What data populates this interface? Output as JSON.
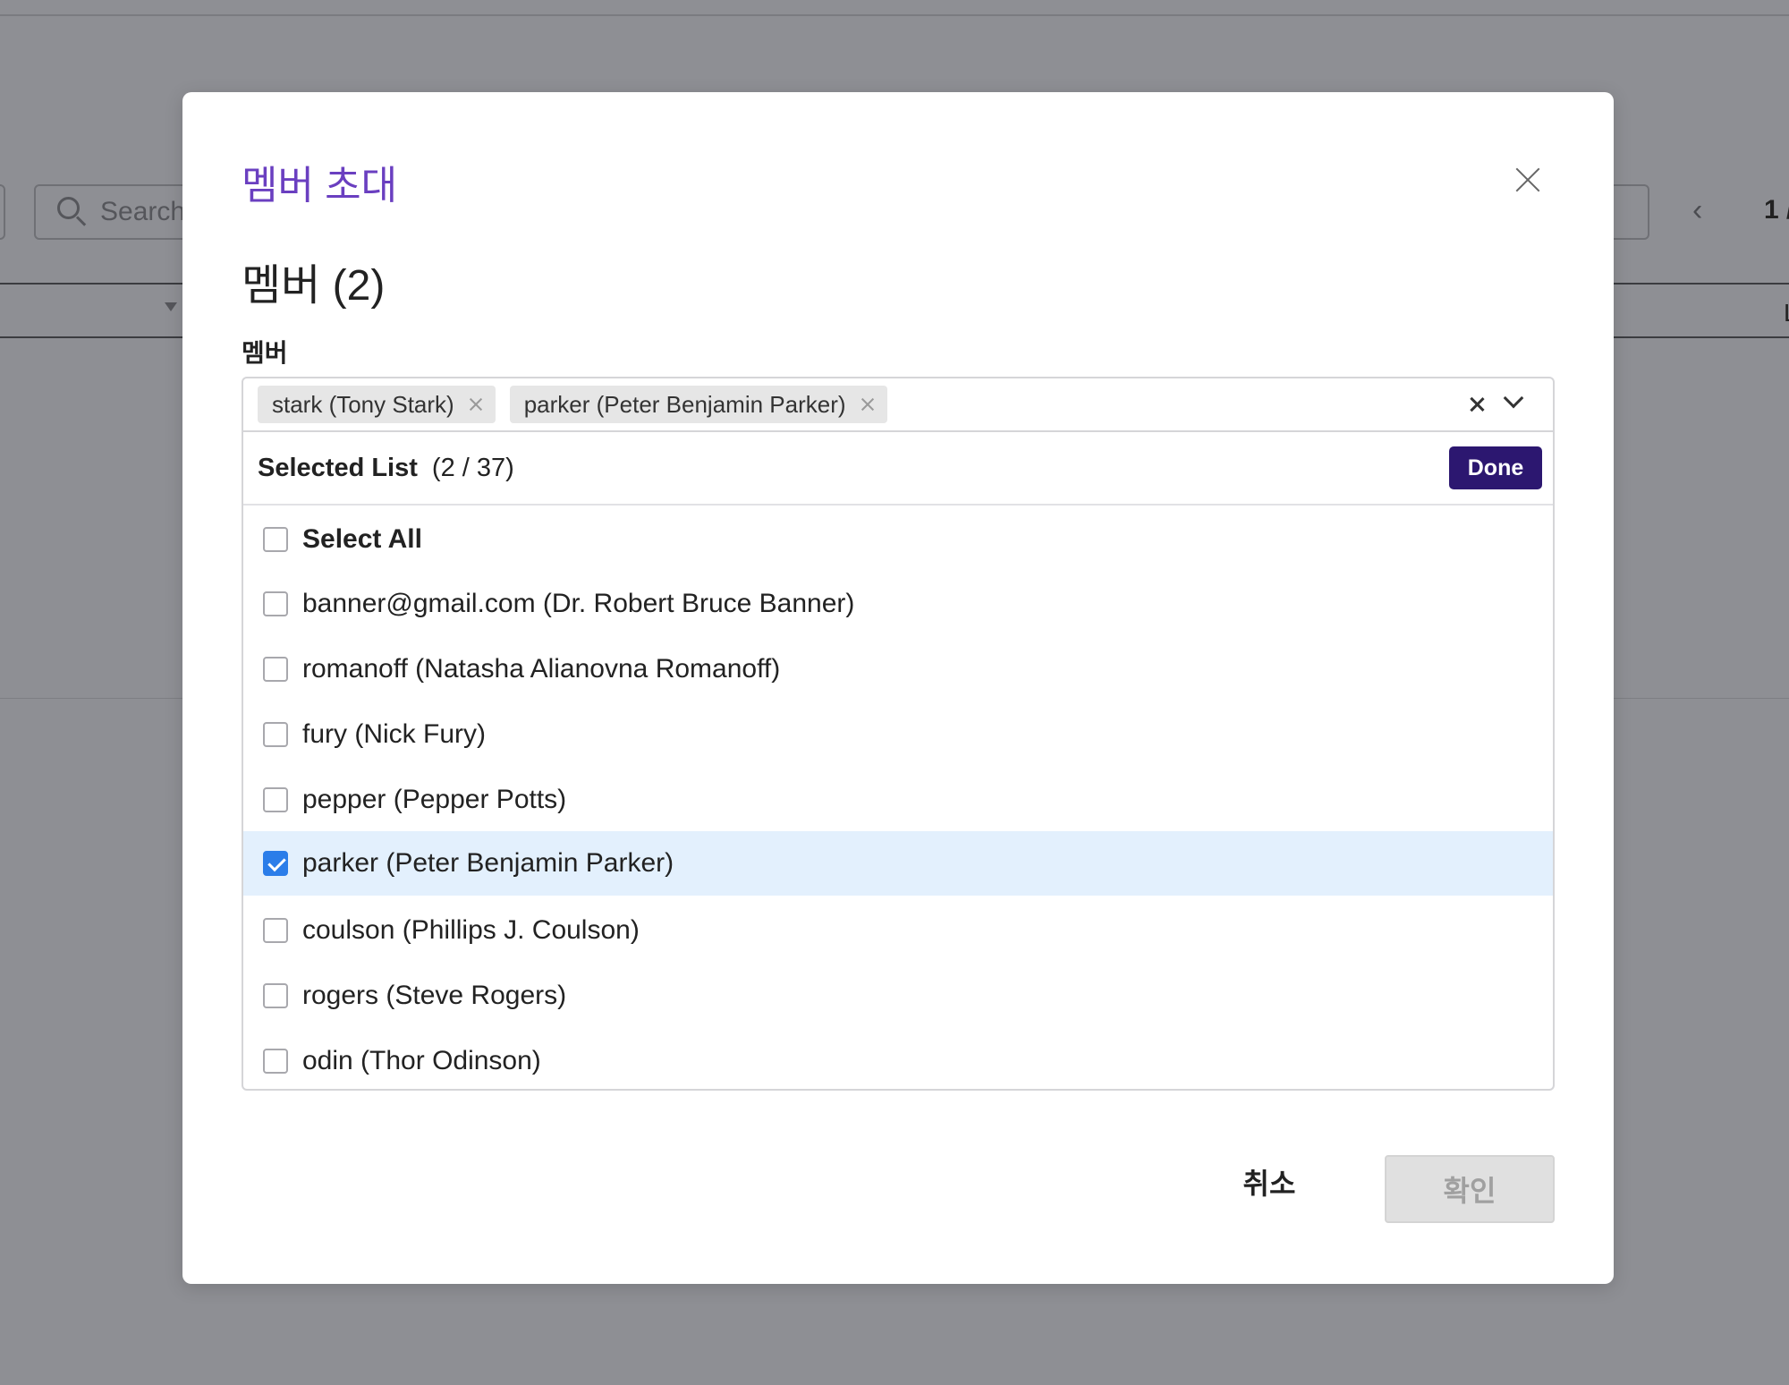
{
  "background": {
    "search_placeholder": "Search",
    "pager_prev": "‹",
    "page_indicator": "1 /",
    "column_partial": "L"
  },
  "modal": {
    "title": "멤버 초대",
    "section_heading": "멤버 (2)",
    "field_label": "멤버",
    "selected_tags": [
      {
        "label": "stark (Tony Stark)"
      },
      {
        "label": "parker (Peter Benjamin Parker)"
      }
    ],
    "dropdown": {
      "header_title": "Selected List",
      "header_count": "(2 / 37)",
      "done_label": "Done",
      "select_all_label": "Select All",
      "options": [
        {
          "label": "banner@gmail.com (Dr. Robert Bruce Banner)",
          "checked": false
        },
        {
          "label": "romanoff (Natasha Alianovna Romanoff)",
          "checked": false
        },
        {
          "label": "fury (Nick Fury)",
          "checked": false
        },
        {
          "label": "pepper (Pepper Potts)",
          "checked": false
        },
        {
          "label": "parker (Peter Benjamin Parker)",
          "checked": true
        },
        {
          "label": "coulson (Phillips J. Coulson)",
          "checked": false
        },
        {
          "label": "rogers (Steve Rogers)",
          "checked": false
        },
        {
          "label": "odin (Thor Odinson)",
          "checked": false
        }
      ]
    },
    "cancel_label": "취소",
    "confirm_label": "확인"
  },
  "colors": {
    "accent_title": "#6a3fc0",
    "done_button": "#2c1770",
    "checkbox_checked": "#2b7de9",
    "selected_row": "#e3f0fd",
    "overlay": "#8e8f94"
  }
}
